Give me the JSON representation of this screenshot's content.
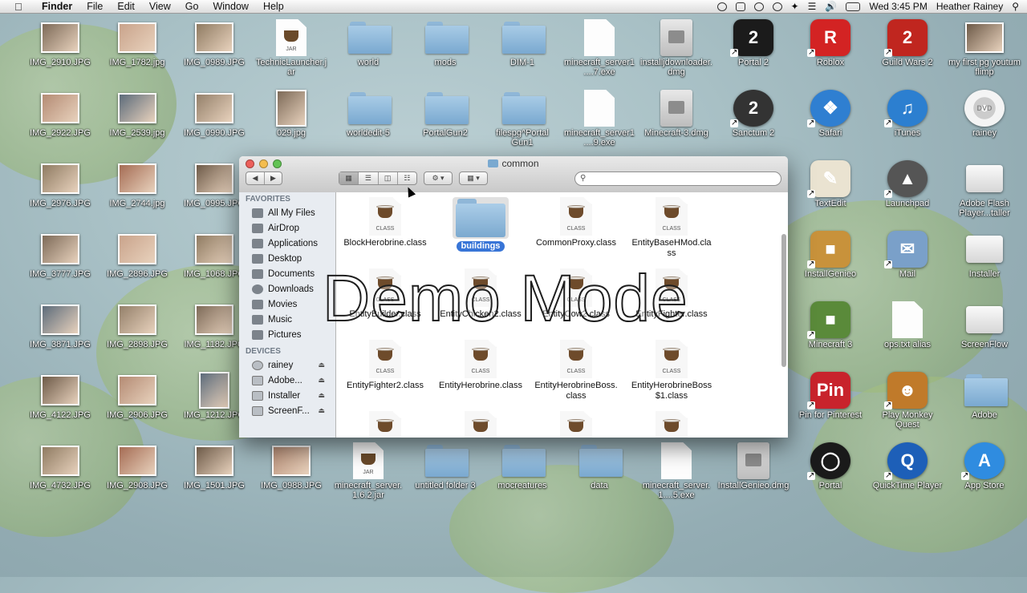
{
  "menubar": {
    "app": "Finder",
    "items": [
      "File",
      "Edit",
      "View",
      "Go",
      "Window",
      "Help"
    ],
    "clock": "Wed 3:45 PM",
    "user": "Heather Rainey"
  },
  "desktop": {
    "icons": [
      {
        "label": "IMG_2910.JPG",
        "kind": "photo"
      },
      {
        "label": "IMG_1782.jpg",
        "kind": "photo"
      },
      {
        "label": "IMG_0989.JPG",
        "kind": "photo"
      },
      {
        "label": "TechnicLauncher.jar",
        "kind": "jar"
      },
      {
        "label": "world",
        "kind": "folder"
      },
      {
        "label": "mods",
        "kind": "folder"
      },
      {
        "label": "DIM-1",
        "kind": "folder"
      },
      {
        "label": "minecraft_server1....7.exe",
        "kind": "doc"
      },
      {
        "label": "installjdownloader.dmg",
        "kind": "disk"
      },
      {
        "label": "Portal 2",
        "kind": "app"
      },
      {
        "label": "Roblox",
        "kind": "app"
      },
      {
        "label": "Guild Wars 2",
        "kind": "app"
      },
      {
        "label": "my first pg youtum flimp",
        "kind": "photo"
      },
      {
        "label": "IMG_2922.JPG",
        "kind": "photo"
      },
      {
        "label": "IMG_2539.jpg",
        "kind": "photo"
      },
      {
        "label": "IMG_0990.JPG",
        "kind": "photo"
      },
      {
        "label": "029.jpg",
        "kind": "photo"
      },
      {
        "label": "worldedit-5",
        "kind": "folder"
      },
      {
        "label": "PortalGun2",
        "kind": "folder"
      },
      {
        "label": "filespg^Portal Gun1",
        "kind": "folder"
      },
      {
        "label": "minecraft_server1....9.exe",
        "kind": "doc"
      },
      {
        "label": "Minecraft-3.dmg",
        "kind": "disk"
      },
      {
        "label": "Sanctum 2",
        "kind": "app"
      },
      {
        "label": "Safari",
        "kind": "app"
      },
      {
        "label": "iTunes",
        "kind": "app"
      },
      {
        "label": "rainey",
        "kind": "disc"
      },
      {
        "label": "IMG_2976.JPG",
        "kind": "photo"
      },
      {
        "label": "IMG_2744.jpg",
        "kind": "photo"
      },
      {
        "label": "IMG_0995.JPG",
        "kind": "photo"
      },
      {
        "label": "TextEdit",
        "kind": "app"
      },
      {
        "label": "Launchpad",
        "kind": "app"
      },
      {
        "label": "Adobe Flash Player...taller",
        "kind": "drive"
      },
      {
        "label": "IMG_3777.JPG",
        "kind": "photo"
      },
      {
        "label": "IMG_2896.JPG",
        "kind": "photo"
      },
      {
        "label": "IMG_1068.JPG",
        "kind": "photo"
      },
      {
        "label": "InstallGenieo",
        "kind": "app"
      },
      {
        "label": "Mail",
        "kind": "app"
      },
      {
        "label": "Installer",
        "kind": "drive"
      },
      {
        "label": "IMG_3871.JPG",
        "kind": "photo"
      },
      {
        "label": "IMG_2898.JPG",
        "kind": "photo"
      },
      {
        "label": "IMG_1182.JPG",
        "kind": "photo"
      },
      {
        "label": "Minecraft 3",
        "kind": "app"
      },
      {
        "label": "ops.txt alias",
        "kind": "doc"
      },
      {
        "label": "ScreenFlow",
        "kind": "drive"
      },
      {
        "label": "IMG_4122.JPG",
        "kind": "photo"
      },
      {
        "label": "IMG_2906.JPG",
        "kind": "photo"
      },
      {
        "label": "IMG_1212.JPG",
        "kind": "photo"
      },
      {
        "label": "Pin for Pinterest",
        "kind": "app"
      },
      {
        "label": "Play Monkey Quest",
        "kind": "app"
      },
      {
        "label": "Adobe",
        "kind": "folder"
      },
      {
        "label": "IMG_4732.JPG",
        "kind": "photo"
      },
      {
        "label": "IMG_2908.JPG",
        "kind": "photo"
      },
      {
        "label": "IMG_1501.JPG",
        "kind": "photo"
      },
      {
        "label": "IMG_0988.JPG",
        "kind": "photo"
      },
      {
        "label": "minecraft_server.1.6.2.jar",
        "kind": "jar"
      },
      {
        "label": "untitled folder 3",
        "kind": "folder"
      },
      {
        "label": "mocreatures",
        "kind": "folder"
      },
      {
        "label": "data",
        "kind": "folder"
      },
      {
        "label": "minecraft_server.1....5.exe",
        "kind": "doc"
      },
      {
        "label": "InstallGenieo.dmg",
        "kind": "disk"
      },
      {
        "label": "Portal",
        "kind": "app"
      },
      {
        "label": "QuickTime Player",
        "kind": "app"
      },
      {
        "label": "App Store",
        "kind": "app"
      }
    ]
  },
  "finder": {
    "title": "common",
    "sidebar": {
      "favorites_header": "FAVORITES",
      "favorites": [
        "All My Files",
        "AirDrop",
        "Applications",
        "Desktop",
        "Documents",
        "Downloads",
        "Movies",
        "Music",
        "Pictures"
      ],
      "devices_header": "DEVICES",
      "devices": [
        "rainey",
        "Adobe...",
        "Installer",
        "ScreenF..."
      ]
    },
    "files": [
      {
        "label": "BlockHerobrine.class",
        "kind": "class"
      },
      {
        "label": "buildings",
        "kind": "folder",
        "selected": true
      },
      {
        "label": "CommonProxy.class",
        "kind": "class"
      },
      {
        "label": "EntityBaseHMod.class",
        "kind": "class"
      },
      {
        "label": "EntityBuilder.class",
        "kind": "class"
      },
      {
        "label": "EntityChicken2.class",
        "kind": "class"
      },
      {
        "label": "EntityCow2.class",
        "kind": "class"
      },
      {
        "label": "EntityFighter.class",
        "kind": "class"
      },
      {
        "label": "EntityFighter2.class",
        "kind": "class"
      },
      {
        "label": "EntityHerobrine.class",
        "kind": "class"
      },
      {
        "label": "EntityHerobrineBoss.class",
        "kind": "class"
      },
      {
        "label": "EntityHerobrineBoss$1.class",
        "kind": "class"
      }
    ],
    "class_tag": "CLASS"
  },
  "overlay": {
    "demo_text": "Demo Mode"
  }
}
